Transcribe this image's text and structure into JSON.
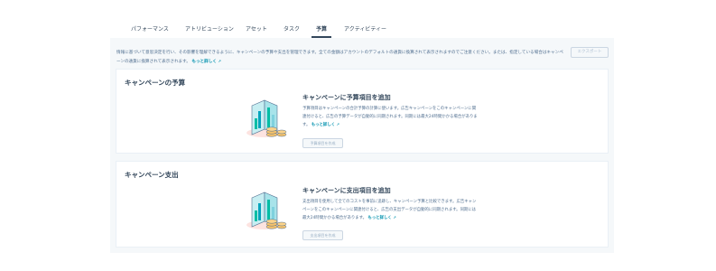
{
  "tabs": [
    {
      "label": "パフォーマンス"
    },
    {
      "label": "アトリビューション"
    },
    {
      "label": "アセット"
    },
    {
      "label": "タスク"
    },
    {
      "label": "予算",
      "active": true
    },
    {
      "label": "アクティビティー"
    }
  ],
  "info": {
    "text": "情報に基づいて意思決定を行い、その影響を理解できるように、キャンペーンの予算や支出を管理できます。全ての金額はアカウントのデフォルトの通貨に換算されて表示されますのでご注意ください。または、指定している場合はキャンペーンの通貨に換算されて表示されます。",
    "link": "もっと詳しく",
    "export_label": "エクスポート"
  },
  "budget_section": {
    "title": "キャンペーンの予算",
    "cta_title": "キャンペーンに予算項目を追加",
    "body": "予算項目はキャンペーンの合計予算の計算に使います。広告キャンペーンをこのキャンペーンに関連付けると、広告の予算データが自動的に同期されます。同期には最大24時間かかる場合があります。",
    "link": "もっと詳しく",
    "button": "予算項目を作成"
  },
  "spend_section": {
    "title": "キャンペーン支出",
    "cta_title": "キャンペーンに支出項目を追加",
    "body": "支出項目を使用して全てのコストを事前に追跡し、キャンペーン予算と比較できます。広告キャンペーンをこのキャンペーンに関連付けると、広告の支出データが自動的に同期されます。同期には最大24時間かかる場合があります。",
    "link": "もっと詳しく",
    "button": "支出項目を作成"
  },
  "icons": {
    "external": "external-link-icon",
    "illustration": "bar-chart-coins-illustration"
  },
  "colors": {
    "link": "#0091ae",
    "text": "#33475b",
    "background": "#f5f8fa"
  }
}
